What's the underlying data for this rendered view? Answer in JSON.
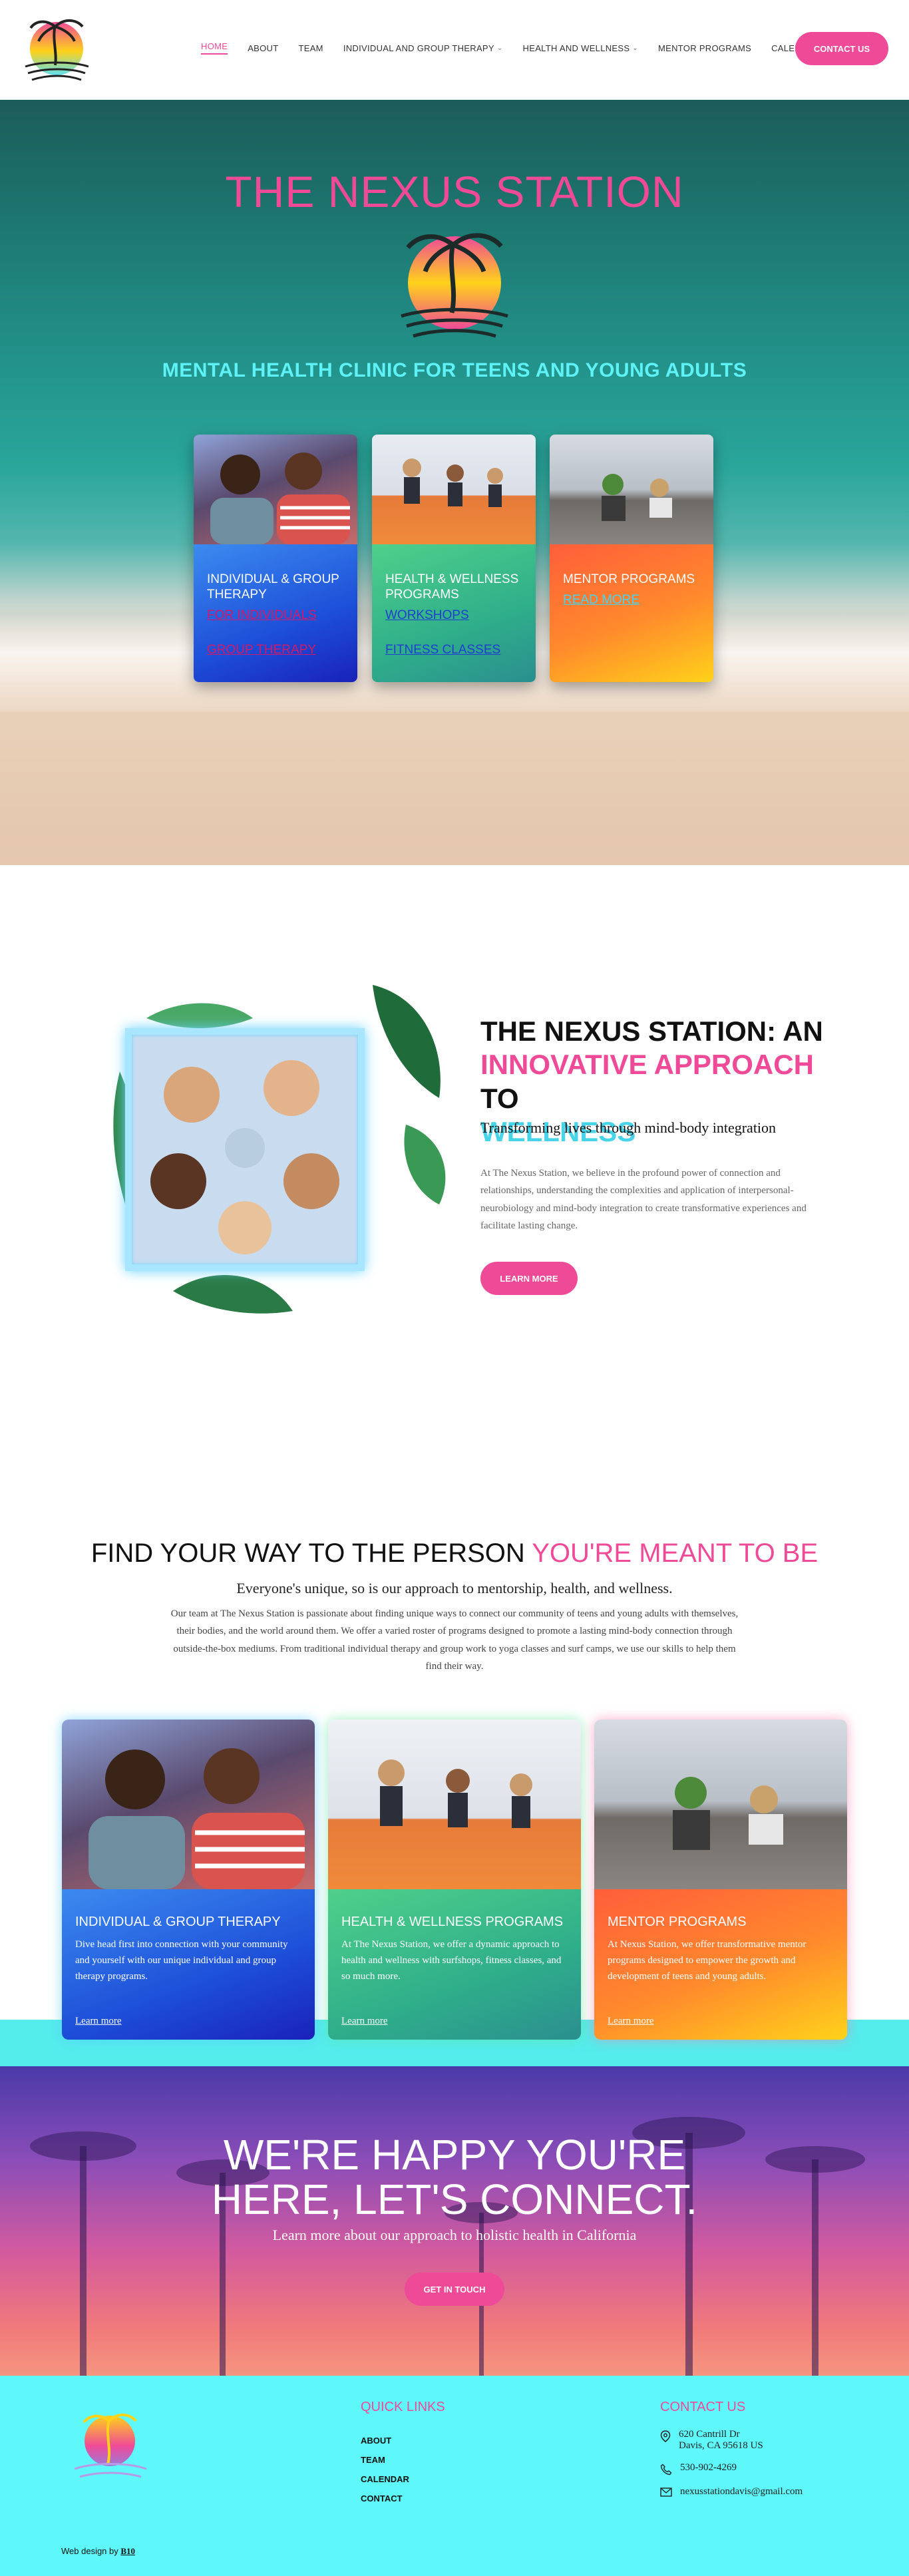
{
  "header": {
    "nav": [
      {
        "label": "HOME",
        "active": true,
        "dropdown": false
      },
      {
        "label": "ABOUT",
        "active": false,
        "dropdown": false
      },
      {
        "label": "TEAM",
        "active": false,
        "dropdown": false
      },
      {
        "label": "INDIVIDUAL AND GROUP THERAPY",
        "active": false,
        "dropdown": true
      },
      {
        "label": "HEALTH AND WELLNESS",
        "active": false,
        "dropdown": true
      },
      {
        "label": "MENTOR PROGRAMS",
        "active": false,
        "dropdown": false
      },
      {
        "label": "CALENDAR",
        "active": false,
        "dropdown": false
      }
    ],
    "contact_button": "CONTACT US"
  },
  "hero": {
    "title": "THE NEXUS STATION",
    "subtitle": "MENTAL HEALTH CLINIC FOR TEENS AND YOUNG ADULTS",
    "cards": [
      {
        "title": "INDIVIDUAL & GROUP THERAPY",
        "links": [
          "FOR INDIVIDUALS",
          "GROUP THERAPY"
        ],
        "link_color": "#d11a6a"
      },
      {
        "title": "HEALTH & WELLNESS PROGRAMS",
        "links": [
          "WORKSHOPS",
          "FITNESS CLASSES"
        ],
        "link_color": "#1e3fd0"
      },
      {
        "title": "MENTOR PROGRAMS",
        "links": [
          "READ MORE"
        ],
        "link_color": "#48d4e8"
      }
    ]
  },
  "intro": {
    "heading_black": "THE NEXUS STATION: AN",
    "heading_pink": "INNOVATIVE APPROACH",
    "heading_to": "TO",
    "heading_cyan": "WELLNESS",
    "subheading": "Transforming lives through mind-body integration",
    "paragraph": "At The Nexus Station, we believe in the profound power of connection and relationships, understanding the complexities and application of interpersonal-neurobiology and mind-body integration to create transformative experiences and facilitate lasting change.",
    "button": "LEARN MORE"
  },
  "find": {
    "heading_black": "FIND YOUR WAY TO THE PERSON",
    "heading_pink": "YOU'RE MEANT TO BE",
    "subheading": "Everyone's unique, so is our approach to mentorship, health, and wellness.",
    "paragraph": "Our team at The Nexus Station is passionate about finding unique ways to connect our community of teens and young adults with themselves, their bodies, and the world around them. We offer a varied roster of programs designed to promote a lasting mind-body connection through outside-the-box mediums. From traditional individual therapy and group work to yoga classes and surf camps, we use our skills to help them find their way.",
    "cards": [
      {
        "title": "INDIVIDUAL & GROUP THERAPY",
        "desc": "Dive head first into connection with your community and yourself with our unique individual and group therapy programs.",
        "more": "Learn more"
      },
      {
        "title": "HEALTH & WELLNESS PROGRAMS",
        "desc": "At The Nexus Station, we offer a dynamic approach to health and wellness with surfshops, fitness classes, and so much more.",
        "more": "Learn more"
      },
      {
        "title": "MENTOR PROGRAMS",
        "desc": "At Nexus Station, we offer transformative mentor programs designed to empower the growth and development of teens and young adults.",
        "more": "Learn more"
      }
    ]
  },
  "connect": {
    "heading_line1": "WE'RE HAPPY YOU'RE",
    "heading_line2": "HERE, LET'S CONNECT.",
    "subheading": "Learn more about our approach to holistic health in California",
    "button": "GET IN TOUCH"
  },
  "footer": {
    "quick_links_title": "QUICK LINKS",
    "quick_links": [
      "ABOUT",
      "TEAM",
      "CALENDAR",
      "CONTACT"
    ],
    "contact_title": "CONTACT US",
    "address_line1": "620 Cantrill Dr",
    "address_line2": "Davis, CA 95618 US",
    "phone": "530-902-4269",
    "email": "nexusstationdavis@gmail.com",
    "credit_prefix": "Web design by",
    "credit_brand": "B10"
  },
  "colors": {
    "pink": "#ef4a98",
    "cyan": "#5ef2f7",
    "footer_bg": "#5ef8fa"
  }
}
